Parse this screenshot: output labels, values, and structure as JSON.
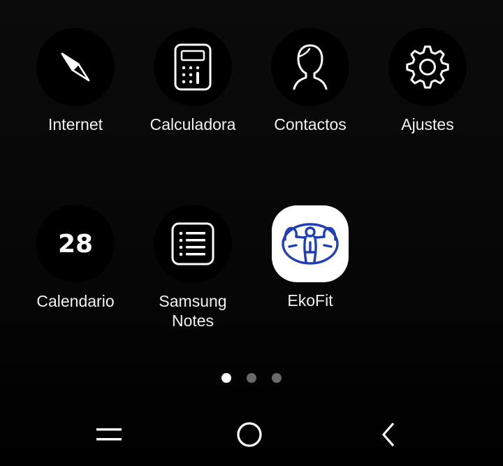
{
  "apps": [
    {
      "label": "Internet",
      "icon": "compass-icon"
    },
    {
      "label": "Calculadora",
      "icon": "calculator-icon"
    },
    {
      "label": "Contactos",
      "icon": "person-silhouette-icon"
    },
    {
      "label": "Ajustes",
      "icon": "gear-icon"
    },
    {
      "label": "Calendario",
      "icon": "calendar-icon",
      "day": "28"
    },
    {
      "label": "Samsung Notes",
      "icon": "notes-list-icon"
    },
    {
      "label": "EkoFit",
      "icon": "bodybuilder-icon"
    }
  ],
  "pagination": {
    "page_count": 3,
    "current_page": 1
  },
  "navbar": {
    "recents": "recents-icon",
    "home": "home-icon",
    "back": "back-icon"
  },
  "colors": {
    "background": "#050505",
    "icon_bg": "#000000",
    "label": "#f2f2f2",
    "ekofit_blue": "#1f3fb8"
  }
}
